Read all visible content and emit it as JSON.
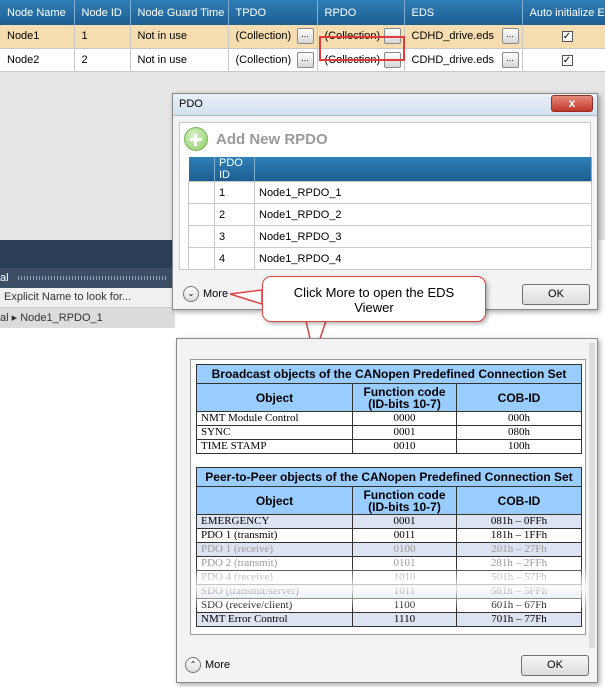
{
  "node_grid": {
    "columns": [
      "Node Name",
      "Node ID",
      "Node Guard Time",
      "TPDO",
      "RPDO",
      "EDS",
      "Auto initialize EDS"
    ],
    "rows": [
      {
        "name": "Node1",
        "id": "1",
        "guard": "Not in use",
        "tpdo": "(Collection)",
        "rpdo": "(Collection)",
        "eds": "CDHD_drive.eds",
        "auto": true
      },
      {
        "name": "Node2",
        "id": "2",
        "guard": "Not in use",
        "tpdo": "(Collection)",
        "rpdo": "(Collection)",
        "eds": "CDHD_drive.eds",
        "auto": true
      }
    ],
    "ellipsis": "...",
    "check": "✓"
  },
  "left_panel": {
    "header": "al",
    "search_placeholder": "Explicit Name to look for...",
    "breadcrumb_prefix": "al",
    "breadcrumb_sep": "▸",
    "breadcrumb_item": "Node1_RPDO_1"
  },
  "pdo_dialog": {
    "title": "PDO",
    "close": "x",
    "add_label": "Add New RPDO",
    "table_header": "PDO ID",
    "rows": [
      {
        "id": "1",
        "name": "Node1_RPDO_1"
      },
      {
        "id": "2",
        "name": "Node1_RPDO_2"
      },
      {
        "id": "3",
        "name": "Node1_RPDO_3"
      },
      {
        "id": "4",
        "name": "Node1_RPDO_4"
      }
    ],
    "more_label": "More",
    "more_icon": "⌄",
    "ok_label": "OK"
  },
  "callout": {
    "text_line1": "Click More to open the EDS",
    "text_line2": "Viewer",
    "color": "#dd4444"
  },
  "eds_viewer": {
    "broadcast": {
      "title": "Broadcast objects of the CANopen Predefined Connection Set",
      "headers": [
        "Object",
        "Function code",
        "(ID-bits 10-7)",
        "COB-ID"
      ],
      "rows": [
        [
          "NMT Module Control",
          "0000",
          "000h"
        ],
        [
          "SYNC",
          "0001",
          "080h"
        ],
        [
          "TIME STAMP",
          "0010",
          "100h"
        ]
      ]
    },
    "p2p": {
      "title": "Peer-to-Peer objects of the CANopen Predefined Connection Set",
      "headers": [
        "Object",
        "Function code",
        "(ID-bits 10-7)",
        "COB-ID"
      ],
      "rows": [
        [
          "EMERGENCY",
          "0001",
          "081h – 0FFh"
        ],
        [
          "PDO 1 (transmit)",
          "0011",
          "181h – 1FFh"
        ],
        [
          "PDO 1 (receive)",
          "0100",
          "201h – 27Fh"
        ],
        [
          "PDO 2 (transmit)",
          "0101",
          "281h – 2FFh"
        ],
        [
          "PDO 4 (receive)",
          "1010",
          "501h – 57Fh"
        ],
        [
          "SDO (transmit/server)",
          "1011",
          "581h – 5FFh"
        ],
        [
          "SDO (receive/client)",
          "1100",
          "601h – 67Fh"
        ],
        [
          "NMT Error Control",
          "1110",
          "701h – 77Fh"
        ]
      ]
    },
    "more_label": "More",
    "more_icon": "⌃",
    "ok_label": "OK"
  }
}
